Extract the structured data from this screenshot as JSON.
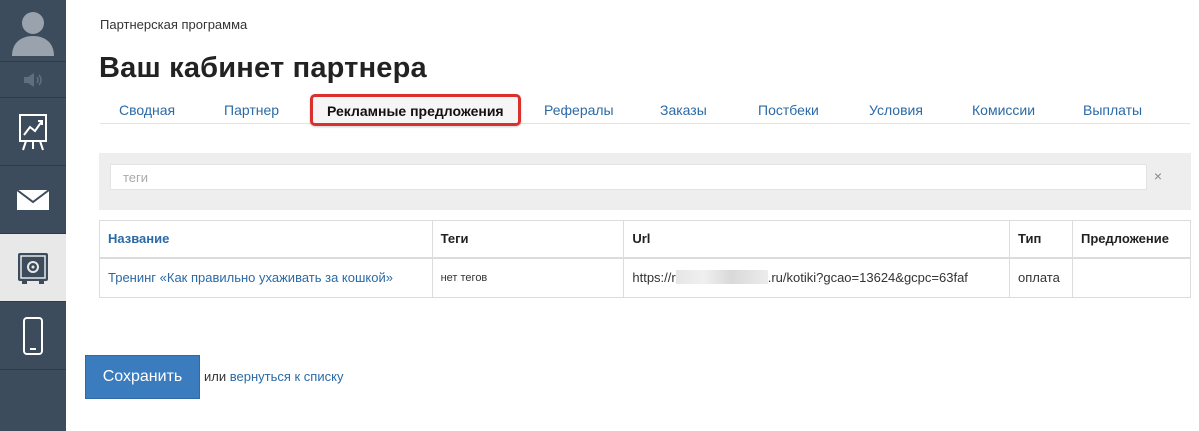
{
  "breadcrumb": "Партнерская программа",
  "page_title": "Ваш кабинет партнера",
  "tabs": [
    {
      "label": "Сводная"
    },
    {
      "label": "Партнер"
    },
    {
      "label": "Рекламные предложения",
      "active": true
    },
    {
      "label": "Рефералы"
    },
    {
      "label": "Заказы"
    },
    {
      "label": "Постбеки"
    },
    {
      "label": "Условия"
    },
    {
      "label": "Комиссии"
    },
    {
      "label": "Выплаты"
    }
  ],
  "filter": {
    "placeholder": "теги",
    "clear_label": "×"
  },
  "table": {
    "headers": [
      "Название",
      "Теги",
      "Url",
      "Тип",
      "Предложение"
    ],
    "rows": [
      {
        "name": "Тренинг «Как правильно ухаживать за кошкой»",
        "tags": "нет тегов",
        "url_prefix": "https://r",
        "url_suffix": ".ru/kotiki?gcao=13624&gcpc=63faf",
        "type": "оплата",
        "offer": ""
      }
    ]
  },
  "actions": {
    "save_label": "Сохранить",
    "or_text": "или",
    "back_link": "вернуться к списку"
  },
  "colors": {
    "sidebar": "#3c4c5c",
    "link": "#2b6aa6",
    "active_tab_border": "#d9322c",
    "primary_button": "#3b7cbf"
  },
  "icons": {
    "avatar": "user-avatar-icon",
    "sound": "speaker-icon",
    "chart": "chart-board-icon",
    "mail": "mail-icon",
    "safe": "safe-icon",
    "phone": "phone-icon"
  }
}
